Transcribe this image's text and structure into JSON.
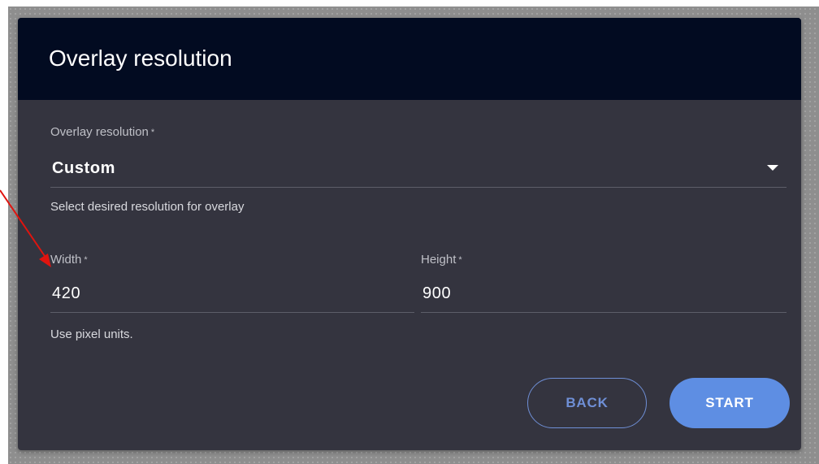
{
  "dialog": {
    "title": "Overlay resolution"
  },
  "resolution_select": {
    "label": "Overlay resolution",
    "required_mark": "*",
    "selected_value": "Custom",
    "helper_text": "Select desired resolution for overlay"
  },
  "width_field": {
    "label": "Width",
    "required_mark": "*",
    "value": "420"
  },
  "height_field": {
    "label": "Height",
    "required_mark": "*",
    "value": "900"
  },
  "dimensions_helper": "Use pixel units.",
  "buttons": {
    "back_label": "BACK",
    "start_label": "START"
  },
  "colors": {
    "header_background": "#020b21",
    "dialog_background": "#34343f",
    "accent": "#5e8ee3",
    "annotation_arrow": "#e0140f"
  },
  "icons": {
    "dropdown": "chevron-down-icon",
    "annotation": "arrow-annotation"
  }
}
